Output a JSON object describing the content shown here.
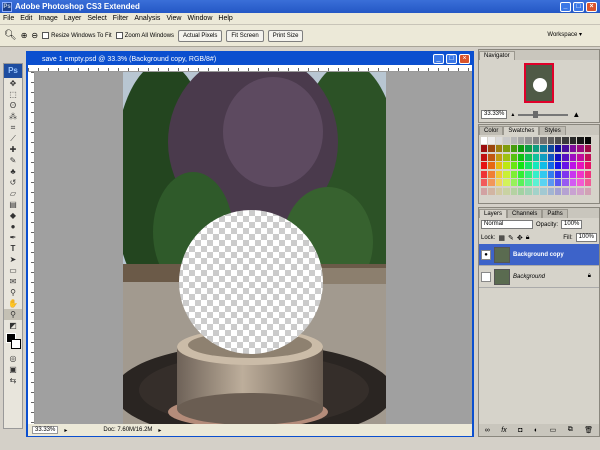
{
  "app": {
    "title": "Adobe Photoshop CS3 Extended",
    "minimize": "_",
    "maximize": "□",
    "close": "×"
  },
  "menu": [
    "File",
    "Edit",
    "Image",
    "Layer",
    "Select",
    "Filter",
    "Analysis",
    "View",
    "Window",
    "Help"
  ],
  "options": {
    "resize_label": "Resize Windows To Fit",
    "zoom_all_label": "Zoom All Windows",
    "actual_pixels": "Actual Pixels",
    "fit_screen": "Fit Screen",
    "print_size": "Print Size",
    "workspace": "Workspace ▾"
  },
  "document": {
    "title": "save 1 empty.psd @ 33.3% (Background copy, RGB/8#)",
    "zoom": "33.33%",
    "doc_info": "Doc: 7.60M/16.2M"
  },
  "navigator": {
    "tab": "Navigator",
    "zoom": "33.33%"
  },
  "swatches": {
    "tabs": [
      "Color",
      "Swatches",
      "Styles"
    ],
    "active": 1
  },
  "layers": {
    "tabs": [
      "Layers",
      "Channels",
      "Paths"
    ],
    "blend_mode": "Normal",
    "opacity_label": "Opacity:",
    "opacity": "100%",
    "lock_label": "Lock:",
    "fill_label": "Fill:",
    "fill": "100%",
    "items": [
      {
        "name": "Background copy",
        "visible": true,
        "selected": true
      },
      {
        "name": "Background",
        "visible": false,
        "selected": false
      }
    ]
  },
  "colors": {
    "title_bar": "#2457c5",
    "document_frame": "#0b4fcf",
    "selected_layer": "#3d63c9"
  }
}
